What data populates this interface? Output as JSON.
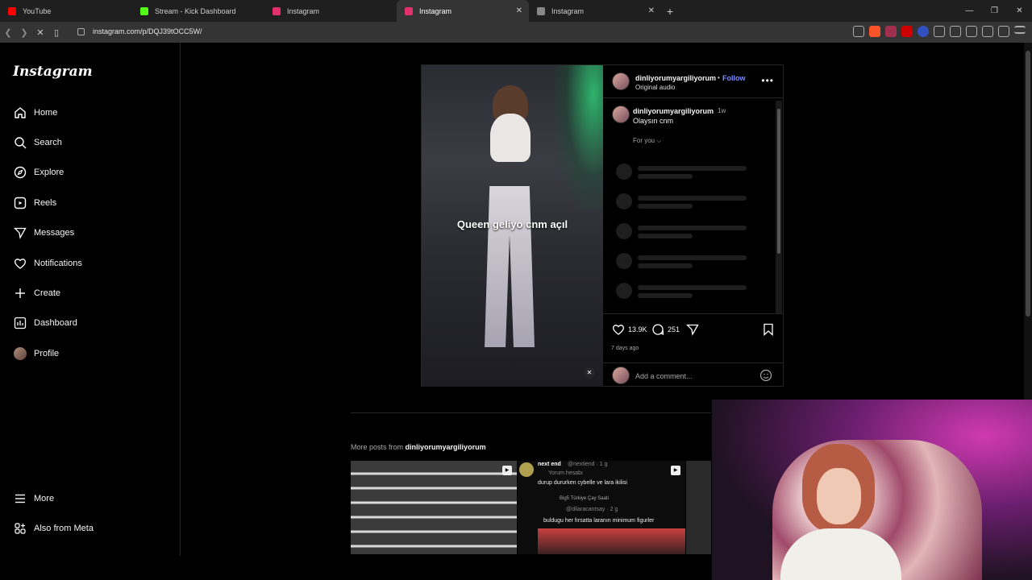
{
  "browser": {
    "tabs": [
      {
        "title": "YouTube",
        "color": "#ff0000",
        "active": false
      },
      {
        "title": "Stream - Kick Dashboard",
        "color": "#53fc18",
        "active": false
      },
      {
        "title": "Instagram",
        "color": "#e1306c",
        "active": false
      },
      {
        "title": "Instagram",
        "color": "#e1306c",
        "active": true
      },
      {
        "title": "Instagram",
        "color": "#888888",
        "active": false
      }
    ],
    "new_tab": "+",
    "url": "instagram.com/p/DQJ39tOCC5W/"
  },
  "sidebar": {
    "logo": "Instagram",
    "items": [
      {
        "label": "Home",
        "icon": "home-icon"
      },
      {
        "label": "Search",
        "icon": "search-icon"
      },
      {
        "label": "Explore",
        "icon": "compass-icon"
      },
      {
        "label": "Reels",
        "icon": "reels-icon"
      },
      {
        "label": "Messages",
        "icon": "messages-icon"
      },
      {
        "label": "Notifications",
        "icon": "heart-icon"
      },
      {
        "label": "Create",
        "icon": "plus-icon"
      },
      {
        "label": "Dashboard",
        "icon": "chart-icon"
      },
      {
        "label": "Profile",
        "icon": "avatar"
      }
    ],
    "more": "More",
    "meta": "Also from Meta"
  },
  "post": {
    "video_caption": "Queen geliyo cnm açıl",
    "author": "dinliyorumyargiliyorum",
    "follow_sep": "•",
    "follow": "Follow",
    "audio": "Original audio",
    "comment_user": "dinliyorumyargiliyorum",
    "comment_time": "1w",
    "comment_text": "Olaysın cnm",
    "for_you": "For you",
    "likes": "13.9K",
    "comments": "251",
    "ago": "7 days ago",
    "add_comment": "Add a comment..."
  },
  "more_posts": {
    "prefix": "More posts from",
    "user": "dinliyorumyargiliyorum",
    "thumb2": {
      "name": "next end",
      "handle": "@nextiend · 1 g",
      "tag": "Yorum hesabı",
      "line1": "durup dururken cybelle ve lara ikilisi",
      "line2": "Big5 Türkiye Çay Saati",
      "handle2": "@dilaracantsay · 2 g",
      "line3": "buldugu her fırsatta laranın minimum figurler"
    }
  }
}
